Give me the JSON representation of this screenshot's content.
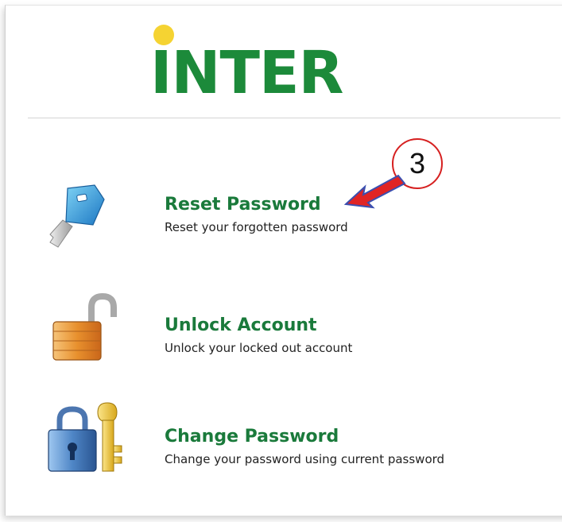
{
  "logo": {
    "text": "INTER"
  },
  "options": [
    {
      "title": "Reset Password",
      "description": "Reset your forgotten password",
      "icon": "key-icon"
    },
    {
      "title": "Unlock Account",
      "description": "Unlock your locked out account",
      "icon": "padlock-open-icon"
    },
    {
      "title": "Change Password",
      "description": "Change your password using current password",
      "icon": "lock-and-key-icon"
    }
  ],
  "annotation": {
    "step": "3",
    "color": "#d62020"
  },
  "colors": {
    "brand_green": "#1c8a3a",
    "logo_dot": "#f5d332",
    "link_green": "#1a7a3b"
  }
}
